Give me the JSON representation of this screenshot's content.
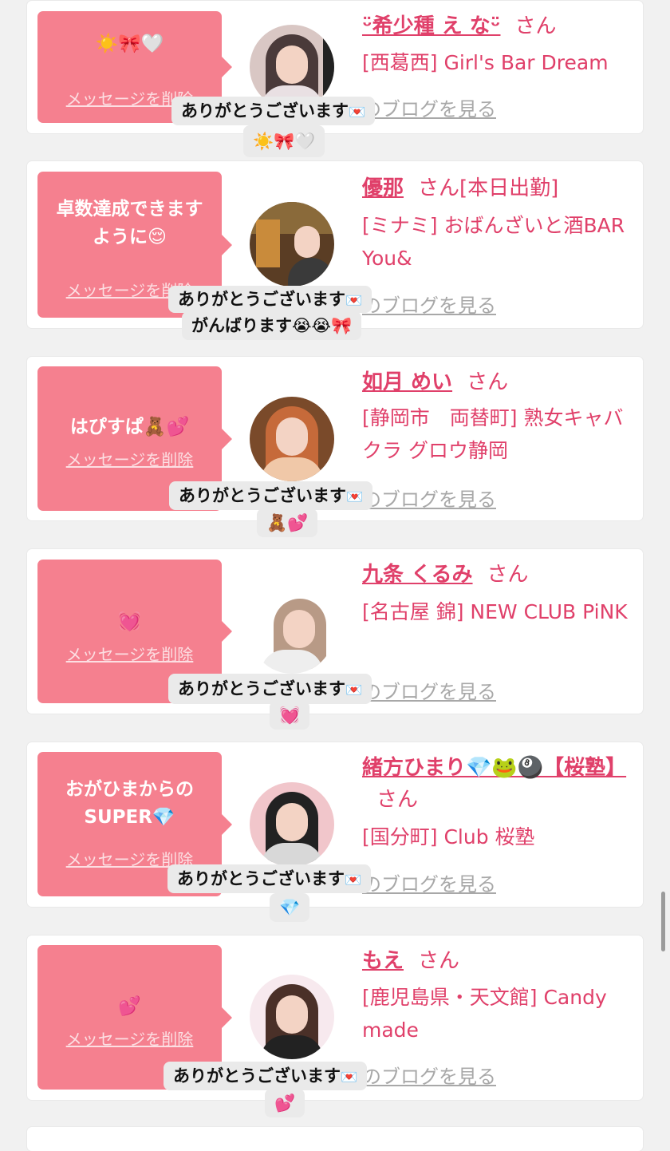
{
  "common": {
    "delete_label": "メッセージを削除",
    "san": "さん",
    "blog_label": "ブログを見る",
    "thanks_label": "ありがとうございます",
    "envelope_icon": "💌"
  },
  "cards": [
    {
      "bubble_text": "☀️🎀🤍",
      "name": "ᵕ̈希少種 え なᵕ̈",
      "status": "",
      "shop": "[西葛西] Girl's Bar Dream",
      "toast_line2": "☀️🎀🤍",
      "avatar_icon": "avatar-photo-icon"
    },
    {
      "bubble_text": "卓数達成できます\nように😌",
      "name": "優那",
      "status": "[本日出勤]",
      "shop": "[ミナミ] おばんざいと酒BAR You&",
      "toast_line2": "がんばります😭😭🎀",
      "avatar_icon": "avatar-photo-icon"
    },
    {
      "bubble_text": "はぴすぱ🧸💕",
      "name": "如月 めい",
      "status": "",
      "shop": "[静岡市　両替町] 熟女キャバクラ グロウ静岡",
      "toast_line2": "🧸💕",
      "avatar_icon": "avatar-photo-icon"
    },
    {
      "bubble_text": "💓",
      "name": "九条 くるみ",
      "status": "",
      "shop": "[名古屋 錦] NEW CLUB PiNK",
      "toast_line2": "💓",
      "avatar_icon": "avatar-photo-icon"
    },
    {
      "bubble_text": "おがひまからの\nSUPER💎",
      "name": "緒方ひまり💎🐸🎱【桜塾】",
      "status": "",
      "shop": "[国分町] Club 桜塾",
      "toast_line2": "💎",
      "avatar_icon": "avatar-photo-icon"
    },
    {
      "bubble_text": "💕",
      "name": "もえ",
      "status": "",
      "shop": "[鹿児島県・天文館] Candy made",
      "toast_line2": "💕",
      "avatar_icon": "avatar-photo-icon"
    }
  ],
  "colors": {
    "accent": "#e0406a",
    "bubble": "#f5808f",
    "page_background": "#f1f1f1"
  }
}
